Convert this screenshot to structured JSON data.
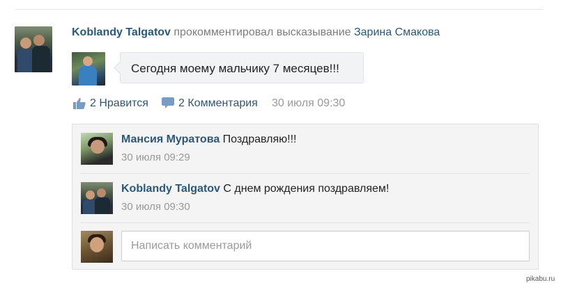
{
  "post": {
    "author": "Koblandy Talgatov",
    "action_text": "прокомментировал высказывание",
    "target_user": "Зарина Смакова",
    "quote_text": "Сегодня моему мальчику 7 месяцев!!!"
  },
  "actions": {
    "likes_label": "2 Нравится",
    "comments_label": "2 Комментария",
    "timestamp": "30 июля 09:30"
  },
  "comments": [
    {
      "author": "Мансия Муратова",
      "text": "Поздравляю!!!",
      "time": "30 июля 09:29"
    },
    {
      "author": "Koblandy Talgatov",
      "text": "С днем рождения поздравляем!",
      "time": "30 июля 09:30"
    }
  ],
  "reply": {
    "placeholder": "Написать комментарий"
  },
  "watermark": "pikabu.ru",
  "colors": {
    "link": "#2b587a",
    "muted": "#999999",
    "panel_bg": "#f4f4f5"
  },
  "icons": {
    "like": "thumbs-up-icon",
    "comment": "speech-bubble-icon"
  }
}
